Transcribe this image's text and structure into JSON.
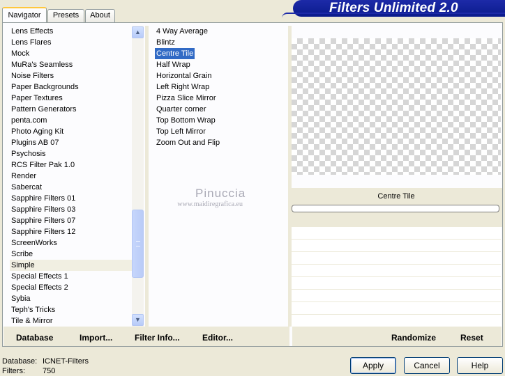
{
  "header": {
    "title": "Filters Unlimited 2.0",
    "tabs": [
      {
        "label": "Navigator",
        "active": true
      },
      {
        "label": "Presets",
        "active": false
      },
      {
        "label": "About",
        "active": false
      }
    ]
  },
  "categories": {
    "items": [
      "Lens Effects",
      "Lens Flares",
      "Mock",
      "MuRa's Seamless",
      "Noise Filters",
      "Paper Backgrounds",
      "Paper Textures",
      "Pattern Generators",
      "penta.com",
      "Photo Aging Kit",
      "Plugins AB 07",
      "Psychosis",
      "RCS Filter Pak 1.0",
      "Render",
      "Sabercat",
      "Sapphire Filters 01",
      "Sapphire Filters 03",
      "Sapphire Filters 07",
      "Sapphire Filters 12",
      "ScreenWorks",
      "Scribe",
      "Simple",
      "Special Effects 1",
      "Special Effects 2",
      "Sybia",
      "Teph's Tricks",
      "Tile & Mirror"
    ],
    "selected": "Simple"
  },
  "filters": {
    "items": [
      "4 Way Average",
      "Blintz",
      "Centre Tile",
      "Half Wrap",
      "Horizontal Grain",
      "Left Right Wrap",
      "Pizza Slice Mirror",
      "Quarter corner",
      "Top Bottom Wrap",
      "Top Left Mirror",
      "Zoom Out and Flip"
    ],
    "selected": "Centre Tile"
  },
  "preview": {
    "filter_name": "Centre Tile",
    "progress": 0
  },
  "watermark": {
    "line1": "Pinuccia",
    "line2": "www.maidiregrafica.eu"
  },
  "toolbar": {
    "database": "Database",
    "import": "Import...",
    "filter_info": "Filter Info...",
    "editor": "Editor...",
    "randomize": "Randomize",
    "reset": "Reset"
  },
  "status": {
    "database_label": "Database:",
    "database_value": "ICNET-Filters",
    "filters_label": "Filters:",
    "filters_value": "750"
  },
  "buttons": {
    "apply": "Apply",
    "cancel": "Cancel",
    "help": "Help"
  },
  "colors": {
    "brand": "#0a1a8c",
    "selection": "#316ac5",
    "tab_highlight": "#ffc73c"
  }
}
